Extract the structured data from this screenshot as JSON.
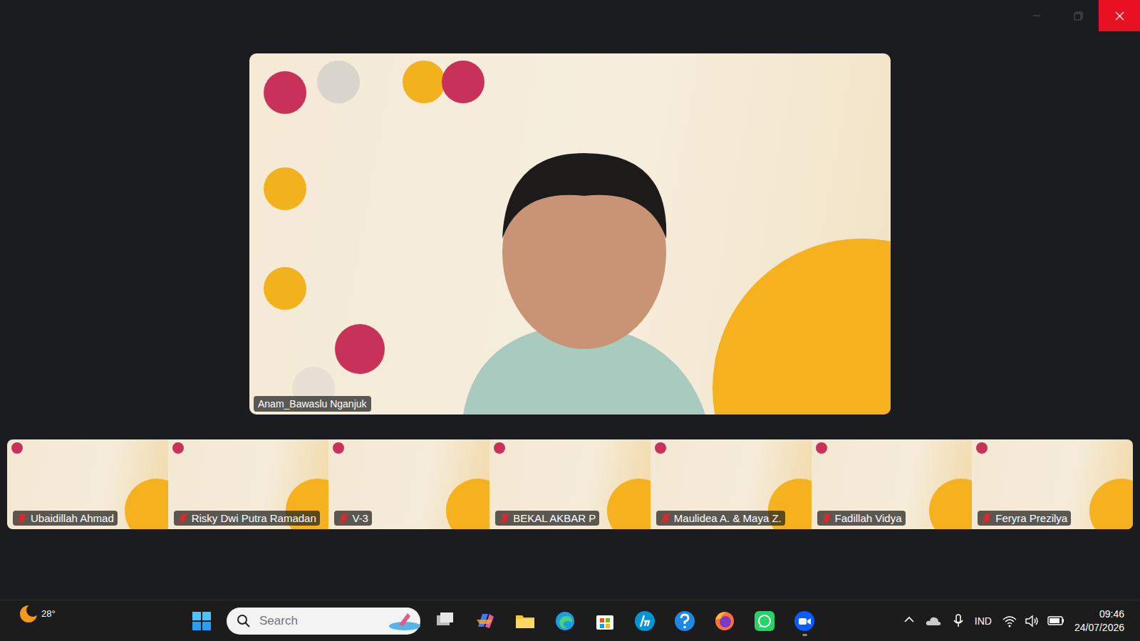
{
  "main_video": {
    "participant": "Anam_Bawaslu Nganjuk",
    "muted": false
  },
  "gallery": [
    {
      "name": "Ubaidillah Ahmad",
      "muted": true
    },
    {
      "name": "Risky Dwi Putra Ramadan",
      "muted": true
    },
    {
      "name": "V-3",
      "muted": true
    },
    {
      "name": "BEKAL AKBAR P",
      "muted": true
    },
    {
      "name": "Maulidea A. & Maya Z.",
      "muted": true
    },
    {
      "name": "Fadillah Vidya",
      "muted": true
    },
    {
      "name": "Feryra Prezilya",
      "muted": true
    }
  ],
  "taskbar": {
    "weather": {
      "temp": "28°"
    },
    "search": {
      "placeholder": "Search"
    },
    "apps": [
      {
        "kind": "taskview",
        "running": false
      },
      {
        "kind": "copilot",
        "running": false
      },
      {
        "kind": "explorer",
        "running": false
      },
      {
        "kind": "edge",
        "running": false
      },
      {
        "kind": "store",
        "running": false
      },
      {
        "kind": "hp",
        "running": false
      },
      {
        "kind": "help",
        "running": false
      },
      {
        "kind": "firefox",
        "running": false
      },
      {
        "kind": "whatsapp",
        "running": false
      },
      {
        "kind": "zoom",
        "running": true
      }
    ],
    "tray": {
      "language": "IND",
      "time": "09:46",
      "date": "24/07/2026"
    }
  }
}
